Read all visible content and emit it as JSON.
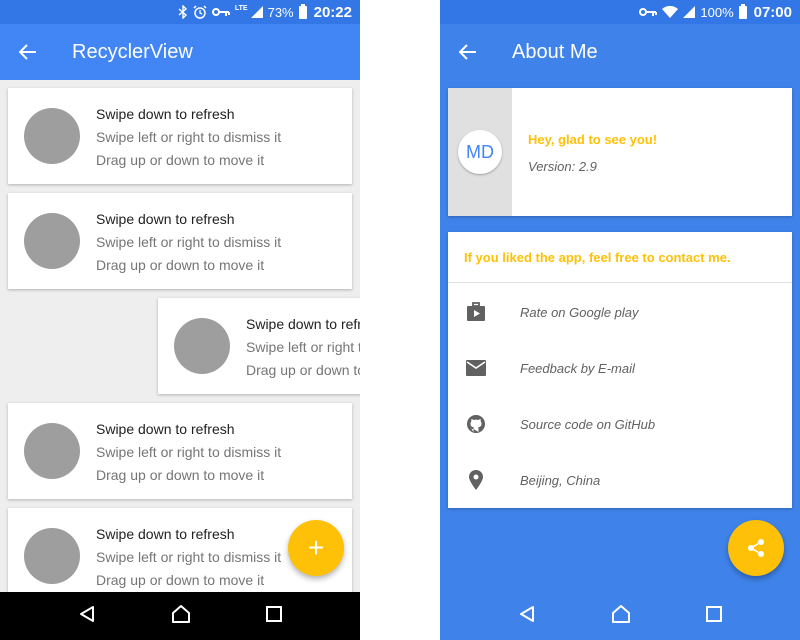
{
  "left": {
    "status": {
      "lte": "LTE",
      "battery": "73%",
      "time": "20:22"
    },
    "toolbar": {
      "title": "RecyclerView"
    },
    "items": [
      {
        "title": "Swipe down to refresh",
        "line2": "Swipe left or right to dismiss it",
        "line3": "Drag up or down to move it"
      },
      {
        "title": "Swipe down to refresh",
        "line2": "Swipe left or right to dismiss it",
        "line3": "Drag up or down to move it"
      },
      {
        "title": "Swipe down to refresh",
        "line2": "Swipe left or right to dismiss it",
        "line3": "Drag up or down to move it"
      },
      {
        "title": "Swipe down to refresh",
        "line2": "Swipe left or right to dismiss it",
        "line3": "Drag up or down to move it"
      },
      {
        "title": "Swipe down to refresh",
        "line2": "Swipe left or right to dismiss it",
        "line3": "Drag up or down to move it"
      }
    ],
    "fab": {
      "icon": "add-icon",
      "glyph": "+"
    }
  },
  "right": {
    "status": {
      "battery": "100%",
      "time": "07:00"
    },
    "toolbar": {
      "title": "About Me"
    },
    "about": {
      "badge": "MD",
      "greeting": "Hey, glad to see you!",
      "version": "Version: 2.9"
    },
    "contact": {
      "heading": "If you liked the app, feel free to contact me.",
      "rows": [
        {
          "icon": "google-play-icon",
          "label": "Rate on Google play"
        },
        {
          "icon": "email-icon",
          "label": "Feedback by E-mail"
        },
        {
          "icon": "github-icon",
          "label": "Source code on GitHub"
        },
        {
          "icon": "location-icon",
          "label": "Beijing, China"
        }
      ]
    },
    "fab": {
      "icon": "share-icon"
    }
  },
  "colors": {
    "primary": "#4285f4",
    "accent": "#ffc107",
    "avatar": "#9e9e9e"
  }
}
